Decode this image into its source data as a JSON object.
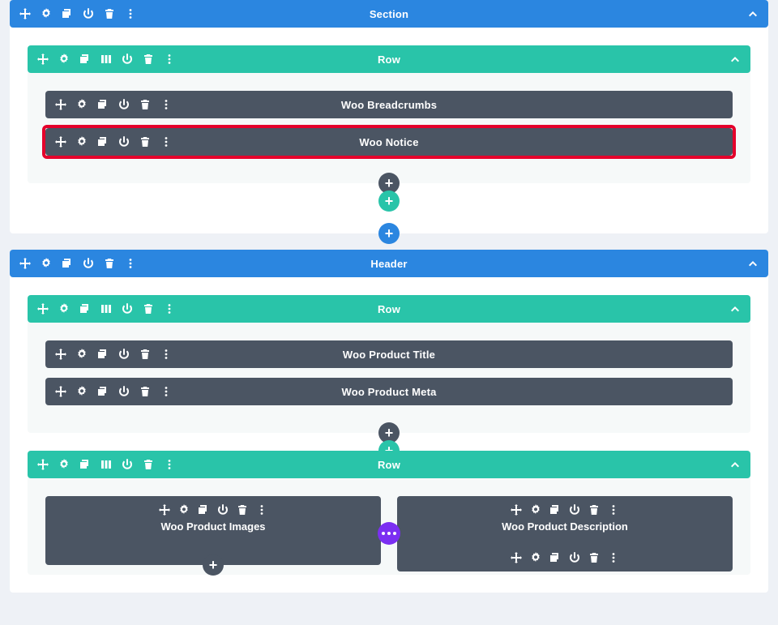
{
  "sections": [
    {
      "title": "Section",
      "rows": [
        {
          "title": "Row",
          "modules": [
            {
              "title": "Woo Breadcrumbs",
              "highlighted": false
            },
            {
              "title": "Woo Notice",
              "highlighted": true
            }
          ]
        }
      ]
    },
    {
      "title": "Header",
      "rows": [
        {
          "title": "Row",
          "modules": [
            {
              "title": "Woo Product Title",
              "highlighted": false
            },
            {
              "title": "Woo Product Meta",
              "highlighted": false
            }
          ]
        },
        {
          "title": "Row",
          "columns": [
            {
              "title": "Woo Product Images"
            },
            {
              "title": "Woo Product Description",
              "extra_menu": true
            }
          ]
        }
      ]
    }
  ],
  "plus": "+"
}
